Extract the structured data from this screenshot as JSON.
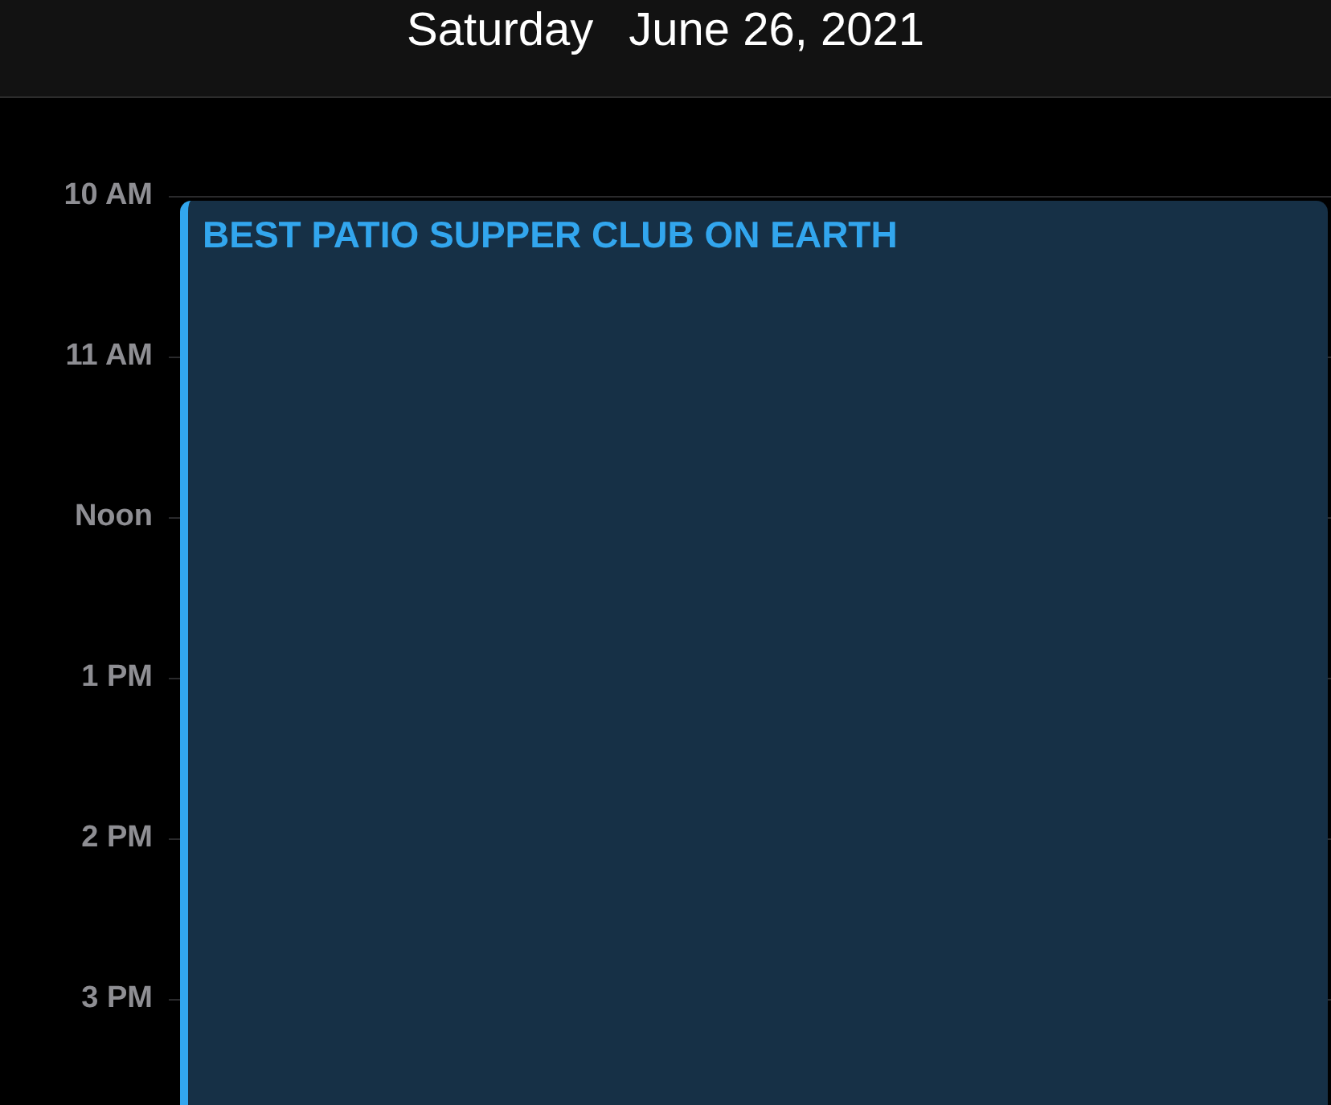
{
  "header": {
    "weekday": "Saturday",
    "date": "June 26, 2021"
  },
  "hours": [
    "10 AM",
    "11 AM",
    "Noon",
    "1 PM",
    "2 PM",
    "3 PM"
  ],
  "events": [
    {
      "title": "BEST PATIO SUPPER CLUB ON EARTH",
      "color": "#32a6ee"
    }
  ]
}
